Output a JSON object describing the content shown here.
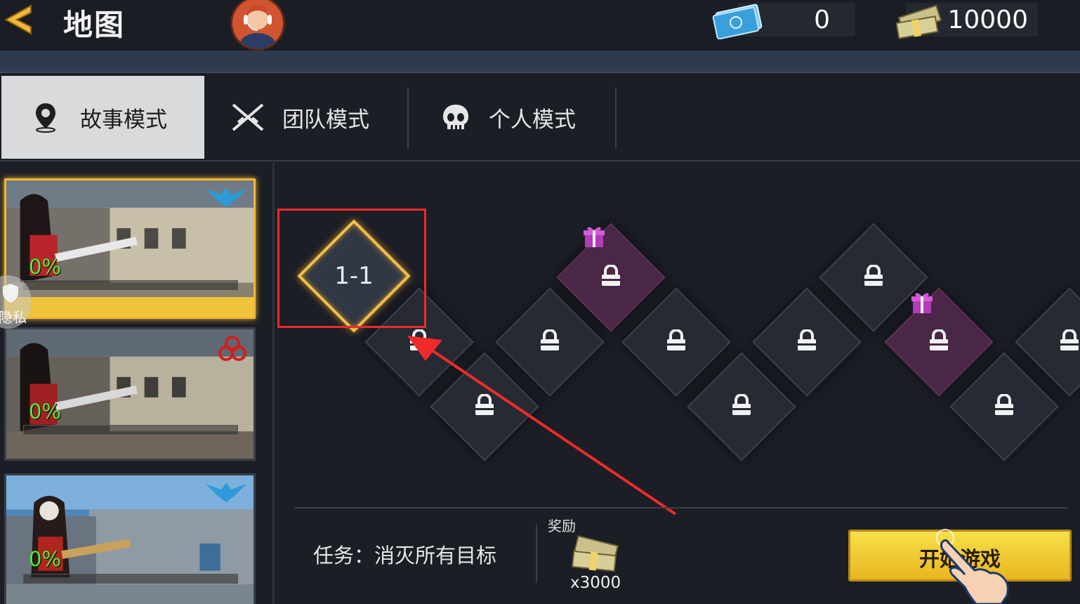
{
  "header": {
    "title": "地图",
    "back_icon": "back-arrow-icon",
    "avatar_icon": "operator-avatar-icon",
    "ticket_count": "0",
    "cash_count": "10000"
  },
  "tabs": [
    {
      "label": "故事模式",
      "icon": "map-pin-icon",
      "active": true
    },
    {
      "label": "团队模式",
      "icon": "crossed-rifles-icon",
      "active": false
    },
    {
      "label": "个人模式",
      "icon": "skull-icon",
      "active": false
    }
  ],
  "maps": [
    {
      "progress_text": "0%",
      "progress": 0,
      "mode_icon": "eagle-icon",
      "selected": true
    },
    {
      "progress_text": "0%",
      "progress": 0,
      "mode_icon": "biohazard-icon",
      "selected": false
    },
    {
      "progress_text": "0%",
      "progress": 0,
      "mode_icon": "eagle-icon",
      "selected": false
    }
  ],
  "privacy_badge": "隐私",
  "levels": {
    "current_label": "1-1",
    "locked_icon": "lock-icon",
    "gift_icon": "gift-icon"
  },
  "bottom": {
    "mission": "任务：消灭所有目标",
    "reward_label": "奖励",
    "reward_icon": "cash-stack-icon",
    "reward_qty": "x3000",
    "start_button": "开始游戏"
  },
  "colors": {
    "accent_gold": "#efc14a",
    "highlight_red": "#ee2a2a",
    "progress_green": "#4ef03a",
    "gift_node_purple": "#4a2746"
  }
}
